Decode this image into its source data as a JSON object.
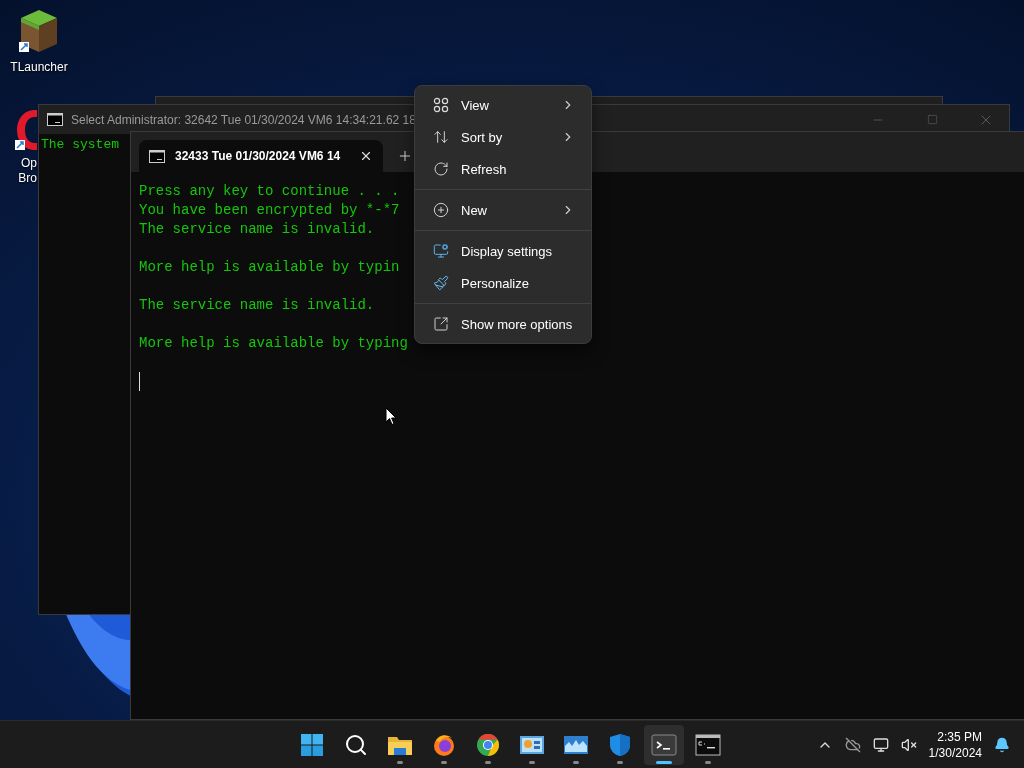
{
  "desktop_icons": [
    {
      "kind": "block",
      "lines": [
        "TLauncher"
      ]
    },
    {
      "kind": "ring",
      "lines": [
        "Op",
        "Bro"
      ]
    }
  ],
  "back_window": {
    "title": "Select Administrator:  32642 Tue 01/30/2024 VM6 14:34:21.62 18",
    "lines": [
      "The system"
    ]
  },
  "terminal": {
    "tabs": [
      {
        "title": "32433 Tue 01/30/2024 VM6 14",
        "selected": true
      }
    ],
    "paragraphs": [
      [
        "Press any key to continue . . .",
        "You have been encrypted by *-*7",
        "The service name is invalid."
      ],
      [
        "More help is available by typin"
      ],
      [
        "The service name is invalid."
      ],
      [
        "More help is available by typing"
      ]
    ]
  },
  "context_menu": {
    "items": [
      {
        "kind": "item",
        "label": "View",
        "submenu": true
      },
      {
        "kind": "item",
        "label": "Sort by",
        "submenu": true
      },
      {
        "kind": "item",
        "label": "Refresh",
        "submenu": false
      },
      {
        "kind": "separator"
      },
      {
        "kind": "item",
        "label": "New",
        "submenu": true
      },
      {
        "kind": "separator"
      },
      {
        "kind": "item",
        "label": "Display settings",
        "submenu": false
      },
      {
        "kind": "item",
        "label": "Personalize",
        "submenu": false
      },
      {
        "kind": "separator"
      },
      {
        "kind": "item",
        "label": "Show more options",
        "submenu": false
      }
    ]
  },
  "taskbar": {
    "apps": [
      {
        "kind": "start",
        "running": false,
        "active": false
      },
      {
        "kind": "search",
        "running": false,
        "active": false
      },
      {
        "kind": "folder",
        "running": true,
        "active": false
      },
      {
        "kind": "firefox",
        "running": true,
        "active": false
      },
      {
        "kind": "chrome",
        "running": true,
        "active": false
      },
      {
        "kind": "dashboard",
        "running": true,
        "active": false
      },
      {
        "kind": "monitor",
        "running": true,
        "active": false
      },
      {
        "kind": "shield",
        "running": true,
        "active": false
      },
      {
        "kind": "terminal",
        "running": true,
        "active": true
      },
      {
        "kind": "cmd",
        "running": true,
        "active": false
      }
    ],
    "time": "2:35 PM",
    "date": "1/30/2024"
  }
}
